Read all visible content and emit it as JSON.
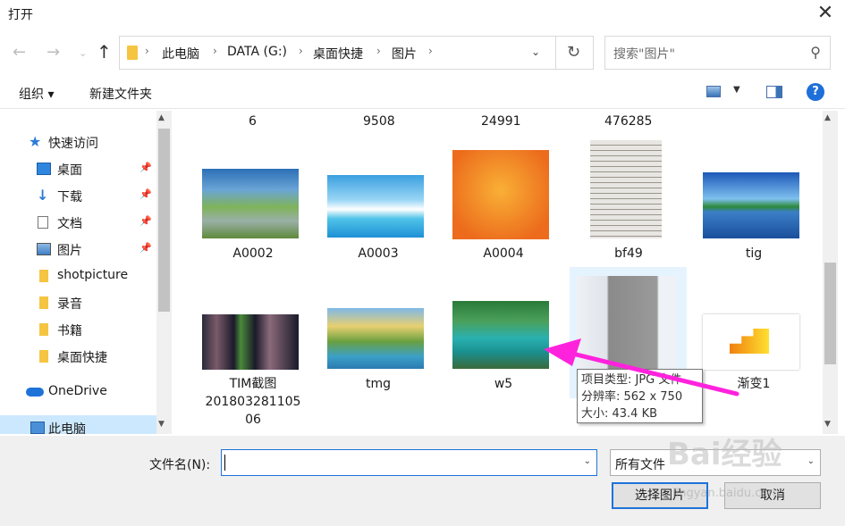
{
  "window": {
    "title": "打开"
  },
  "address": {
    "crumbs": [
      "此电脑",
      "DATA (G:)",
      "桌面快捷",
      "图片"
    ],
    "search_placeholder": "搜索\"图片\""
  },
  "toolbar": {
    "organize": "组织 ▾",
    "new_folder": "新建文件夹"
  },
  "nav": {
    "items": [
      {
        "label": "快速访问",
        "icon": "star-icon"
      },
      {
        "label": "桌面",
        "icon": "desktop-icon"
      },
      {
        "label": "下载",
        "icon": "download-icon"
      },
      {
        "label": "文档",
        "icon": "document-icon"
      },
      {
        "label": "图片",
        "icon": "pictures-icon"
      },
      {
        "label": "shotpicture",
        "icon": "folder-icon"
      },
      {
        "label": "录音",
        "icon": "folder-icon"
      },
      {
        "label": "书籍",
        "icon": "folder-icon"
      },
      {
        "label": "桌面快捷",
        "icon": "folder-icon"
      },
      {
        "label": "OneDrive",
        "icon": "cloud-icon"
      },
      {
        "label": "此电脑",
        "icon": "computer-icon"
      }
    ]
  },
  "files": {
    "top_row": [
      "6",
      "9508",
      "24991",
      "476285"
    ],
    "row1": [
      "A0002",
      "A0003",
      "A0004",
      "bf49",
      "tig"
    ],
    "row2": [
      "TIM截图201803281105 06",
      "tmg",
      "w5",
      "",
      "渐变1"
    ],
    "tim_lines": [
      "TIM截图",
      "201803281105",
      "06"
    ]
  },
  "tooltip": {
    "type": "项目类型: JPG 文件",
    "resolution": "分辨率: 562 x 750",
    "size": "大小: 43.4 KB"
  },
  "bottom": {
    "filename_label": "文件名(N):",
    "filename_value": "",
    "filter": "所有文件",
    "open_button": "选择图片",
    "cancel_button": "取消"
  },
  "watermark": {
    "text": "Bai经验",
    "sub": "jingyan.baidu.com"
  },
  "colors": {
    "accent": "#1e73d9",
    "selected": "#cce8ff",
    "hover": "#e5f3ff",
    "arrow": "#ff22dd"
  }
}
